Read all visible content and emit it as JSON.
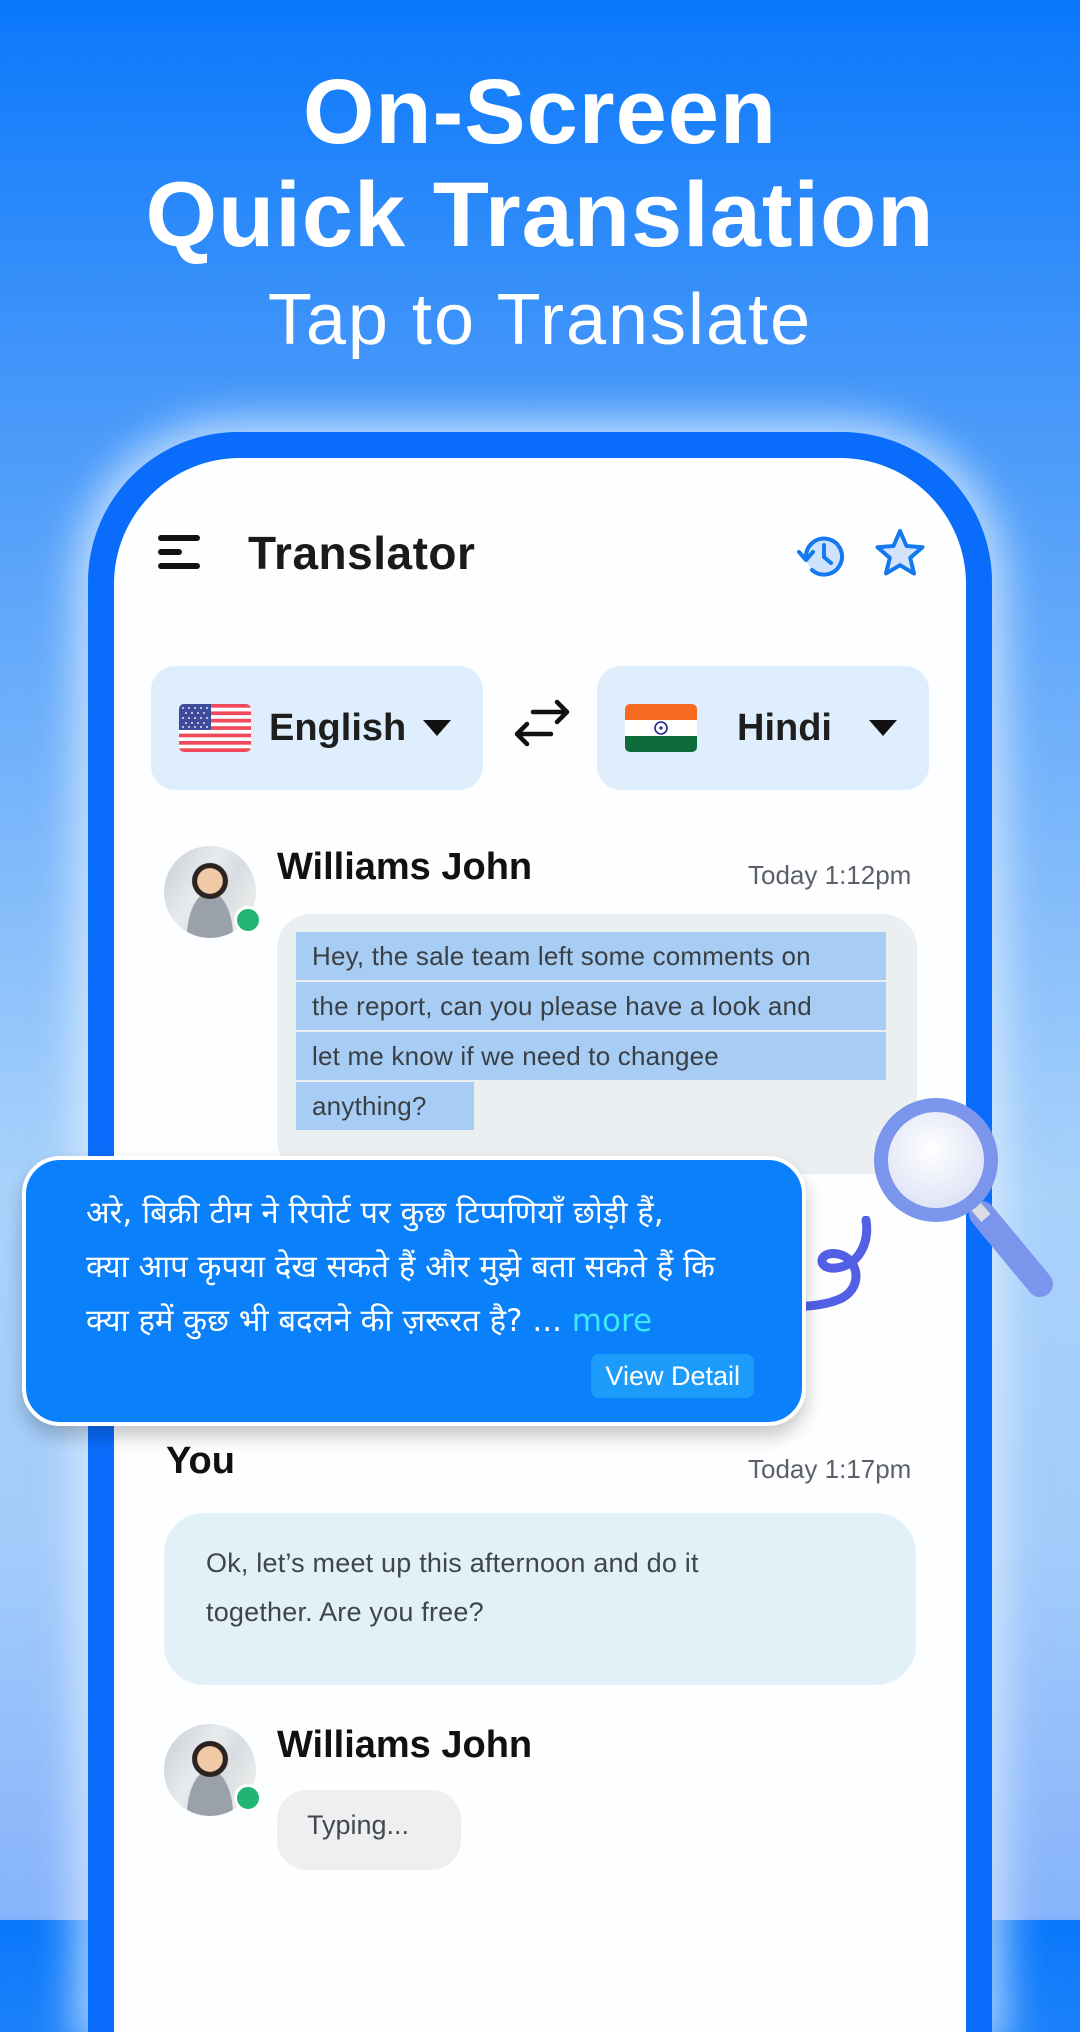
{
  "hero": {
    "title_line1": "On-Screen",
    "title_line2": "Quick Translation",
    "subtitle": "Tap to Translate"
  },
  "app": {
    "title": "Translator",
    "icons": {
      "menu": "menu-icon",
      "history": "history-icon",
      "favorites": "star-icon",
      "swap": "swap-arrows-icon",
      "magnifier": "magnifier-icon"
    },
    "colors": {
      "accent": "#0a6cfb",
      "popup": "#0a80fb",
      "more_link": "#3fe7f4",
      "online": "#20b572",
      "highlight": "#a8cdf4"
    }
  },
  "languages": {
    "source": {
      "name": "English",
      "flag": "us-flag"
    },
    "target": {
      "name": "Hindi",
      "flag": "india-flag"
    }
  },
  "messages": [
    {
      "sender": "Williams John",
      "time": "Today 1:12pm",
      "online": true,
      "lines": [
        "Hey, the sale team left some comments on",
        "the report, can you please have a look and",
        "let me know if we need to changee",
        "anything?"
      ]
    },
    {
      "sender": "You",
      "time": "Today 1:17pm",
      "lines": [
        "Ok, let’s meet up this afternoon and do it",
        "together. Are you free?"
      ]
    },
    {
      "sender": "Williams John",
      "online": true,
      "typing": "Typing..."
    }
  ],
  "translation_popup": {
    "lines": [
      "अरे, बिक्री टीम ने रिपोर्ट पर कुछ टिप्पणियाँ छोड़ी हैं,",
      "क्या आप कृपया देख सकते हैं और मुझे बता सकते हैं कि",
      "क्या हमें कुछ भी बदलने की ज़रूरत है? ..."
    ],
    "more_label": "more",
    "view_detail_label": "View Detail"
  }
}
